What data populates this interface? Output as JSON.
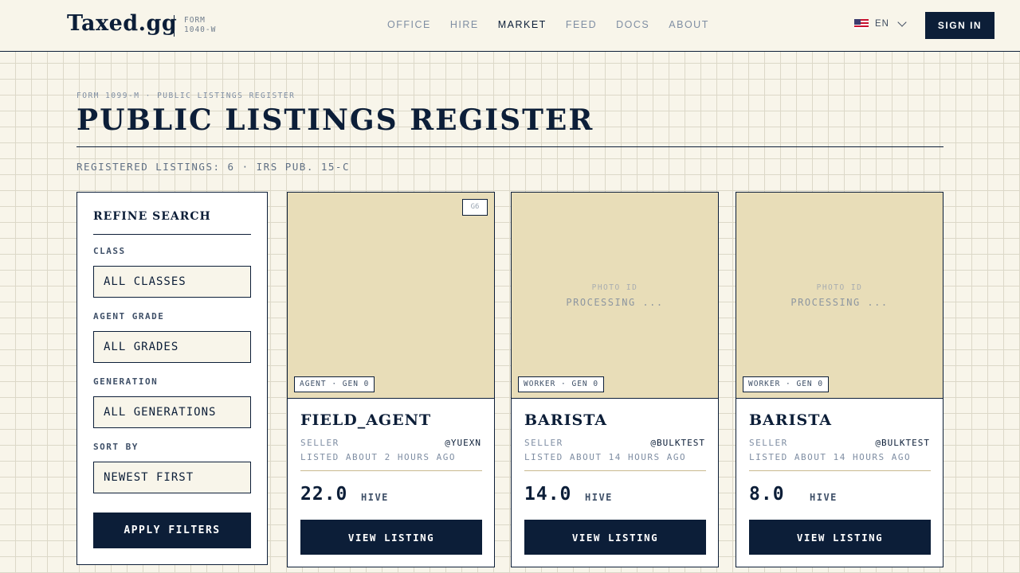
{
  "header": {
    "logo": "Taxed.gg",
    "form_tag_line1": "FORM",
    "form_tag_line2": "1040-W",
    "nav": [
      "OFFICE",
      "HIRE",
      "MARKET",
      "FEED",
      "DOCS",
      "ABOUT"
    ],
    "active_nav": "MARKET",
    "language": "EN",
    "sign_in": "SIGN IN"
  },
  "page": {
    "breadcrumb": "FORM 1099-M · PUBLIC LISTINGS REGISTER",
    "title": "PUBLIC LISTINGS REGISTER",
    "subtitle": "REGISTERED LISTINGS: 6 · IRS PUB. 15-C"
  },
  "filters": {
    "title": "REFINE SEARCH",
    "class_label": "CLASS",
    "class_value": "ALL CLASSES",
    "grade_label": "AGENT GRADE",
    "grade_value": "ALL GRADES",
    "generation_label": "GENERATION",
    "generation_value": "ALL GENERATIONS",
    "sort_label": "SORT BY",
    "sort_value": "NEWEST FIRST",
    "apply": "APPLY FILTERS"
  },
  "listings": [
    {
      "grade_badge": "G6",
      "photo_status_small": "",
      "photo_status": "",
      "tag": "AGENT · GEN 0",
      "name": "FIELD_AGENT",
      "seller_label": "SELLER",
      "seller": "@YUEXN",
      "listed": "LISTED ABOUT 2 HOURS AGO",
      "price": "22.0",
      "currency": "HIVE",
      "button": "VIEW LISTING"
    },
    {
      "grade_badge": "",
      "photo_status_small": "PHOTO ID",
      "photo_status": "PROCESSING ...",
      "tag": "WORKER · GEN 0",
      "name": "BARISTA",
      "seller_label": "SELLER",
      "seller": "@BULKTEST",
      "listed": "LISTED ABOUT 14 HOURS AGO",
      "price": "14.0",
      "currency": "HIVE",
      "button": "VIEW LISTING"
    },
    {
      "grade_badge": "",
      "photo_status_small": "PHOTO ID",
      "photo_status": "PROCESSING ...",
      "tag": "WORKER · GEN 0",
      "name": "BARISTA",
      "seller_label": "SELLER",
      "seller": "@BULKTEST",
      "listed": "LISTED ABOUT 14 HOURS AGO",
      "price": "8.0",
      "currency": "HIVE",
      "button": "VIEW LISTING"
    }
  ],
  "colors": {
    "navy": "#0c1e38",
    "paper": "#f8f5ea",
    "photo_bg": "#e8ddb8",
    "grid": "#dcd8c8"
  }
}
